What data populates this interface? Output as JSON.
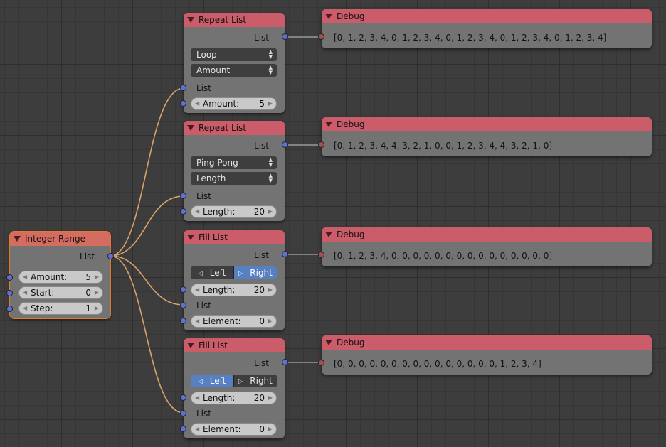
{
  "integer_range": {
    "title": "Integer Range",
    "output_label": "List",
    "fields": [
      {
        "label": "Amount:",
        "value": "5"
      },
      {
        "label": "Start:",
        "value": "0"
      },
      {
        "label": "Step:",
        "value": "1"
      }
    ]
  },
  "repeat1": {
    "title": "Repeat  List",
    "output_label": "List",
    "mode": "Loop",
    "unit": "Amount",
    "input_label": "List",
    "field": {
      "label": "Amount:",
      "value": "5"
    }
  },
  "repeat2": {
    "title": "Repeat  List",
    "output_label": "List",
    "mode": "Ping Pong",
    "unit": "Length",
    "input_label": "List",
    "field": {
      "label": "Length:",
      "value": "20"
    }
  },
  "fill1": {
    "title": "Fill List",
    "output_label": "List",
    "left": "Left",
    "right": "Right",
    "selected": "Right",
    "length": {
      "label": "Length:",
      "value": "20"
    },
    "input_label": "List",
    "element": {
      "label": "Element:",
      "value": "0"
    }
  },
  "fill2": {
    "title": "Fill List",
    "output_label": "List",
    "left": "Left",
    "right": "Right",
    "selected": "Left",
    "length": {
      "label": "Length:",
      "value": "20"
    },
    "input_label": "List",
    "element": {
      "label": "Element:",
      "value": "0"
    }
  },
  "debug": [
    {
      "title": "Debug",
      "text": "[0, 1, 2, 3, 4, 0, 1, 2, 3, 4, 0, 1, 2, 3, 4, 0, 1, 2, 3, 4, 0, 1, 2, 3, 4]"
    },
    {
      "title": "Debug",
      "text": "[0, 1, 2, 3, 4, 4, 3, 2, 1, 0, 0, 1, 2, 3, 4, 4, 3, 2, 1, 0]"
    },
    {
      "title": "Debug",
      "text": "[0, 1, 2, 3, 4, 0, 0, 0, 0, 0, 0, 0, 0, 0, 0, 0, 0, 0, 0, 0]"
    },
    {
      "title": "Debug",
      "text": "[0, 0, 0, 0, 0, 0, 0, 0, 0, 0, 0, 0, 0, 0, 0, 1, 2, 3, 4]"
    }
  ],
  "colors": {
    "header_red": "#cb5c6a",
    "header_orange": "#d46d5f",
    "link": "#d9a36a",
    "socket_list": "#5f6fd3",
    "socket_debug": "#a05050",
    "toggle_on": "#5680c2"
  }
}
